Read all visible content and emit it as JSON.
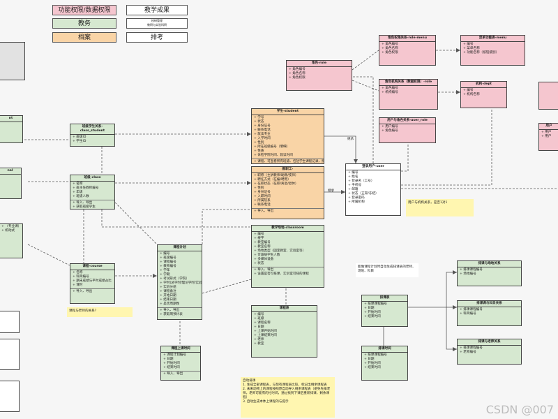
{
  "legend": {
    "function_data": "功能权限/数据权限",
    "teaching": "教学成果",
    "academic": "教务",
    "research": "校研管理",
    "research_sub": "教研与实验科研",
    "archive": "档案",
    "schedule": "排考"
  },
  "boxes": {
    "class_student": {
      "title": "班级学生关系-class_student",
      "fields": [
        "班级ID",
        "学生ID"
      ],
      "footer": []
    },
    "class": {
      "title": "班级-class",
      "fields": [
        "名称",
        "班主任教师编号",
        "年级",
        "班级人数"
      ],
      "footer": [
        "导入、导出",
        "获取班级学生"
      ]
    },
    "course": {
      "title": "课程-course",
      "fields": [
        "名称",
        "科目编号",
        "期末成绩与平时成绩占比",
        "课时"
      ],
      "footer": [
        "导入、导出"
      ]
    },
    "plan": {
      "title": "课程计划",
      "fields": [
        "编号",
        "班级编号",
        "课程编号",
        "教师编号",
        "学年",
        "学期",
        "考试形式（学院）",
        "学时(总学时/理论学时/实验学时",
        "实验分组",
        "课程备注",
        "开始日期",
        "结束日期",
        "是否周期性"
      ],
      "footer": [
        "导入、导出",
        "获取周预计表"
      ]
    },
    "schedule_plan": {
      "title": "课程上课时间",
      "fields": [
        "课程计划编号",
        "日期",
        "开始时间",
        "结束时间"
      ],
      "footer": [
        "导入、导出"
      ]
    },
    "student": {
      "title": "学生-student",
      "fields": [
        "学号",
        "状态",
        "身份证号",
        "联系电话",
        "就读专业",
        "入学时间",
        "性别",
        "所在班级编号（明细）",
        "性质",
        "体检学院时间、就读时间"
      ],
      "footer": [
        "课程、可查看所有班级、包括学生课程记录、照片时间的、数据"
      ]
    },
    "teacher": {
      "title": "教职工-",
      "fields": [
        "职称（主讲教师/助教/技师）",
        "聘任方式（在编/聘用）",
        "在职状态（在职/离退/退休）",
        "性别",
        "身份证号",
        "入职时间",
        "所属院系",
        "联系电话"
      ],
      "footer": [
        "导入、导出"
      ]
    },
    "user": {
      "title": "登录用户-user",
      "fields": [
        "编号",
        "姓名",
        "登录名（工号）",
        "手机号",
        "邮箱",
        "状态（正常/冻结）",
        "登录密码",
        "所属机构"
      ],
      "footer": []
    },
    "classroom": {
      "title": "教学场地-classroom",
      "fields": [
        "编号",
        "楼宇",
        "教室编号",
        "教室名称",
        "场地类型（固定教室、实验室等）",
        "可容纳学生人数",
        "多媒体设备",
        "状态"
      ],
      "footer": [
        "导入、导出",
        "设置是否可排课、实训室可排的课程"
      ]
    },
    "schedule": {
      "title": "课程表",
      "fields": [
        "编号",
        "班级",
        "课程名称",
        "日期",
        "上课开始时间",
        "上课结束时间",
        "老师",
        "教室"
      ],
      "footer": []
    },
    "role": {
      "title": "角色-role",
      "fields": [
        "角色编号",
        "角色名称",
        "角色权限"
      ],
      "footer": []
    },
    "role_menu": {
      "title": "角色权限关系-role-menu",
      "fields": [
        "角色编号",
        "角色名称",
        "角色权限"
      ],
      "footer": []
    },
    "menu": {
      "title": "菜单功能表-menu",
      "fields": [
        "编号",
        "菜单名称",
        "功能名称（按钮级别）"
      ],
      "footer": []
    },
    "role_dept": {
      "title": "角色机构关系（数据权限）-role",
      "fields": [
        "角色编号",
        "机构编号"
      ],
      "footer": []
    },
    "dept": {
      "title": "机构-dept",
      "fields": [
        "编号",
        "机构名称"
      ],
      "footer": []
    },
    "user_role": {
      "title": "用户与角色关系-user_role",
      "fields": [
        "用户编号",
        "角色编号"
      ],
      "footer": []
    },
    "exam": {
      "title": "排课表",
      "fields": [
        "排课课程编号",
        "日期",
        "开始时间",
        "结束时间"
      ],
      "footer": []
    },
    "exam_time": {
      "title": "排课时间",
      "fields": [
        "排课课程编号",
        "日期",
        "开始时间",
        "结束时间"
      ],
      "footer": []
    },
    "exam_room": {
      "title": "排课与场地关系",
      "fields": [
        "排课课程编号",
        "场地编号"
      ],
      "footer": []
    },
    "exam_subject": {
      "title": "排课课与科目关系",
      "fields": [
        "排课课程编号",
        "科目编号"
      ],
      "footer": []
    },
    "exam_teacher": {
      "title": "排课与老师关系",
      "fields": [
        "排课课程编号",
        "老师编号"
      ],
      "footer": []
    },
    "left_a": {
      "title": "",
      "fields": [],
      "footer": []
    },
    "left_b": {
      "title": "nt",
      "fields": [],
      "footer": []
    },
    "left_c": {
      "title": "nal",
      "fields": [],
      "footer": []
    },
    "left_d": {
      "title": "",
      "fields": [
        "（专业课）",
        "机动式"
      ],
      "footer": []
    },
    "right_a": {
      "title": "",
      "fields": [],
      "footer": []
    },
    "right_b": {
      "title": "用户",
      "fields": [
        "用户",
        "用户"
      ],
      "footer": []
    }
  },
  "notes": {
    "course_note": "课程与老师的关系?",
    "user_note": "用户与机构关系，是否1对1",
    "plan_note": "能做课程计划时自动生成排课表的老师、场地、科目",
    "auto_schedule": "自动排课\n1. 生成全部课程表，与现有课程表比较，标记出剩余课程表\n2. 未来动物上的课程按照原自动导入剩余课程表（避免先排老师，老师可能有的忙时间，通过找到下课后重新排课，剩余课程）\n3. 自动生成本体上课程的与提示"
  },
  "connectors": {
    "inherit_1": "继承",
    "inherit_2": "继承"
  },
  "watermark": "CSDN @007"
}
